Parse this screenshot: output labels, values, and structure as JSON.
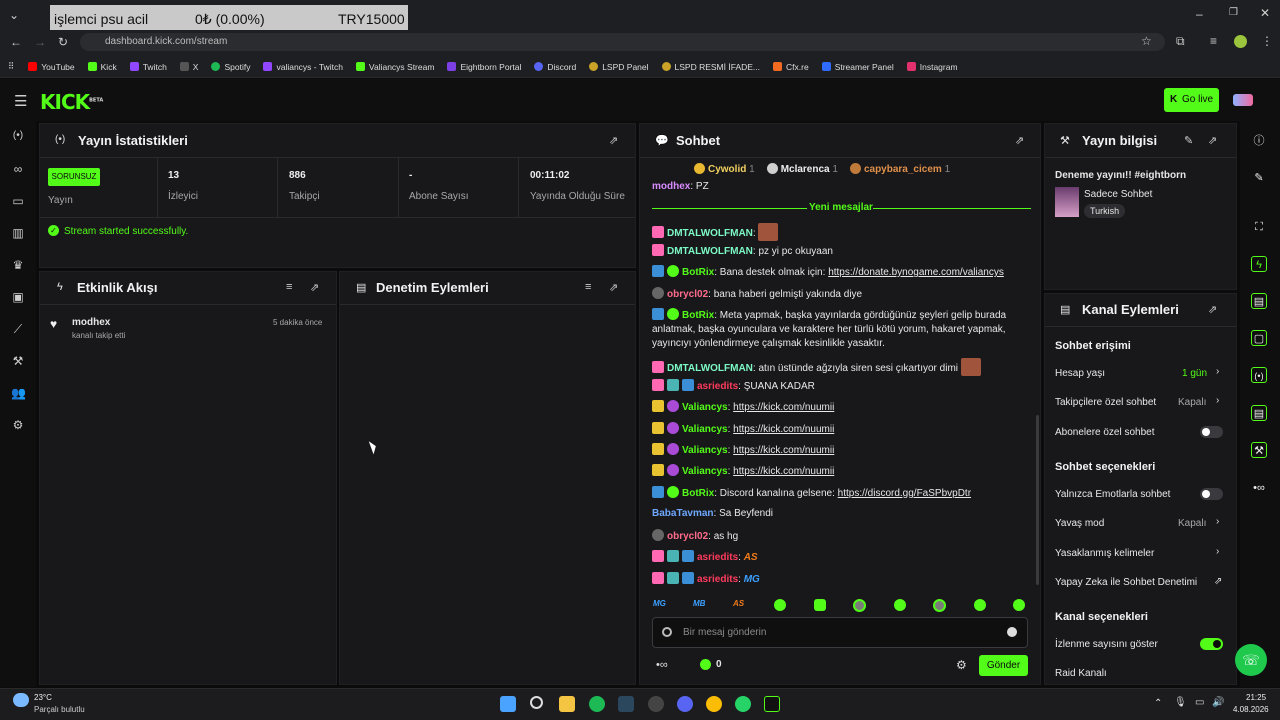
{
  "browser": {
    "overlay": {
      "title": "işlemci psu acil",
      "amount": "0₺ (0.00%)",
      "goal": "TRY15000"
    },
    "url": "dashboard.kick.com/stream",
    "bookmarks": [
      {
        "label": "YouTube",
        "color": "#ff0000"
      },
      {
        "label": "Kick",
        "color": "#53fc18"
      },
      {
        "label": "Twitch",
        "color": "#9146ff"
      },
      {
        "label": "X",
        "color": "#ffffff"
      },
      {
        "label": "Spotify",
        "color": "#1db954"
      },
      {
        "label": "valiancys - Twitch",
        "color": "#9146ff"
      },
      {
        "label": "Valiancys Stream",
        "color": "#53fc18"
      },
      {
        "label": "Eightborn Portal",
        "color": "#7b3fe4"
      },
      {
        "label": "Discord",
        "color": "#5865f2"
      },
      {
        "label": "LSPD Panel",
        "color": "#c9a227"
      },
      {
        "label": "LSPD  RESMİ İFADE...",
        "color": "#c9a227"
      },
      {
        "label": "Cfx.re",
        "color": "#f26b21"
      },
      {
        "label": "Streamer Panel",
        "color": "#2f6bff"
      },
      {
        "label": "Instagram",
        "color": "#e1306c"
      }
    ]
  },
  "header": {
    "logo": "KICK",
    "logo_sup": "BETA",
    "go_live": "Go live"
  },
  "stats": {
    "title": "Yayın İstatistikleri",
    "status_badge": "SORUNSUZ",
    "status_label": "Yayın",
    "items": [
      {
        "value": "13",
        "label": "İzleyici"
      },
      {
        "value": "886",
        "label": "Takipçi"
      },
      {
        "value": "-",
        "label": "Abone Sayısı"
      },
      {
        "value": "00:11:02",
        "label": "Yayında Olduğu Süre"
      }
    ],
    "message": "Stream started successfully."
  },
  "activity": {
    "title": "Etkinlik Akışı",
    "items": [
      {
        "user": "modhex",
        "text": "kanalı takip etti",
        "time": "5 dakika önce"
      }
    ]
  },
  "moderation": {
    "title": "Denetim Eylemleri"
  },
  "chat": {
    "title": "Sohbet",
    "top": [
      {
        "name": "Cywolid",
        "count": "1",
        "rank": "1"
      },
      {
        "name": "Mclarenca",
        "count": "1",
        "rank": "2"
      },
      {
        "name": "capybara_cicem",
        "count": "1",
        "rank": "3"
      }
    ],
    "first_line": {
      "user": "modhex",
      "text": "PZ"
    },
    "new_messages": "Yeni mesajlar",
    "messages": [
      {
        "user": "DMTALWOLFMAN",
        "color": "#7df9c5",
        "text": ":",
        "emote": true
      },
      {
        "user": "DMTALWOLFMAN",
        "color": "#7df9c5",
        "text": ": pz yi pc okuyaan"
      },
      {
        "user": "BotRix",
        "color": "#53fc18",
        "text": ": Bana destek olmak için: ",
        "link": "https://donate.bynogame.com/valiancys"
      },
      {
        "user": "obrycl02",
        "color": "#ff6b8a",
        "text": ": bana haberi gelmişti yakında diye"
      },
      {
        "user": "BotRix",
        "color": "#53fc18",
        "text": ": Meta yapmak, başka yayınlarda gördüğünüz şeyleri gelip burada anlatmak, başka oyunculara ve karaktere her türlü kötü yorum, hakaret yapmak, yayıncıyı yönlendirmeye çalışmak kesinlikle yasaktır."
      },
      {
        "user": "DMTALWOLFMAN",
        "color": "#7df9c5",
        "text": ": atın üstünde ağzıyla siren sesi çıkartıyor dimi",
        "emote": true
      },
      {
        "user": "asriedits",
        "color": "#ff3b5c",
        "text": ": ŞUANA KADAR"
      },
      {
        "user": "Valiancys",
        "color": "#53fc18",
        "text": ": ",
        "link": "https://kick.com/nuumii"
      },
      {
        "user": "Valiancys",
        "color": "#53fc18",
        "text": ": ",
        "link": "https://kick.com/nuumii"
      },
      {
        "user": "Valiancys",
        "color": "#53fc18",
        "text": ": ",
        "link": "https://kick.com/nuumii"
      },
      {
        "user": "Valiancys",
        "color": "#53fc18",
        "text": ": ",
        "link": "https://kick.com/nuumii"
      },
      {
        "user": "BotRix",
        "color": "#53fc18",
        "text": ": Discord kanalına gelsene: ",
        "link": "https://discord.gg/FaSPbvpDtr"
      },
      {
        "user": "BabaTavman",
        "color": "#6ea8ff",
        "text": ": Sa Beyfendi"
      },
      {
        "user": "obrycl02",
        "color": "#ff6b8a",
        "text": ": as hg"
      },
      {
        "user": "asriedits",
        "color": "#ff3b5c",
        "text": ": ",
        "tag": "AS"
      },
      {
        "user": "asriedits",
        "color": "#ff3b5c",
        "text": ": ",
        "tag": "MG"
      }
    ],
    "emote_bar": [
      "MG",
      "MB",
      "AS"
    ],
    "input_placeholder": "Bir mesaj gönderin",
    "points": "0",
    "send": "Gönder"
  },
  "stream_info": {
    "title": "Yayın bilgisi",
    "stream_title": "Deneme yayını!! #eightborn",
    "category": "Sadece Sohbet",
    "language": "Turkish"
  },
  "channel_actions": {
    "title": "Kanal Eylemleri",
    "section_chat_access": "Sohbet erişimi",
    "account_age_label": "Hesap yaşı",
    "account_age_value": "1 gün",
    "followers_only_label": "Takipçilere özel sohbet",
    "followers_only_value": "Kapalı",
    "subs_only_label": "Abonelere özel sohbet",
    "section_chat_options": "Sohbet seçenekleri",
    "emote_only_label": "Yalnızca Emotlarla sohbet",
    "slow_mode_label": "Yavaş mod",
    "slow_mode_value": "Kapalı",
    "banned_words_label": "Yasaklanmış kelimeler",
    "ai_moderation_label": "Yapay Zeka ile Sohbet Denetimi",
    "section_channel_options": "Kanal seçenekleri",
    "show_viewers_label": "İzlenme sayısını göster",
    "raid_label": "Raid Kanalı"
  },
  "taskbar": {
    "weather_temp": "23°C",
    "weather_desc": "Parçalı bulutlu",
    "time": "21:25",
    "date": "4.08.2026"
  }
}
